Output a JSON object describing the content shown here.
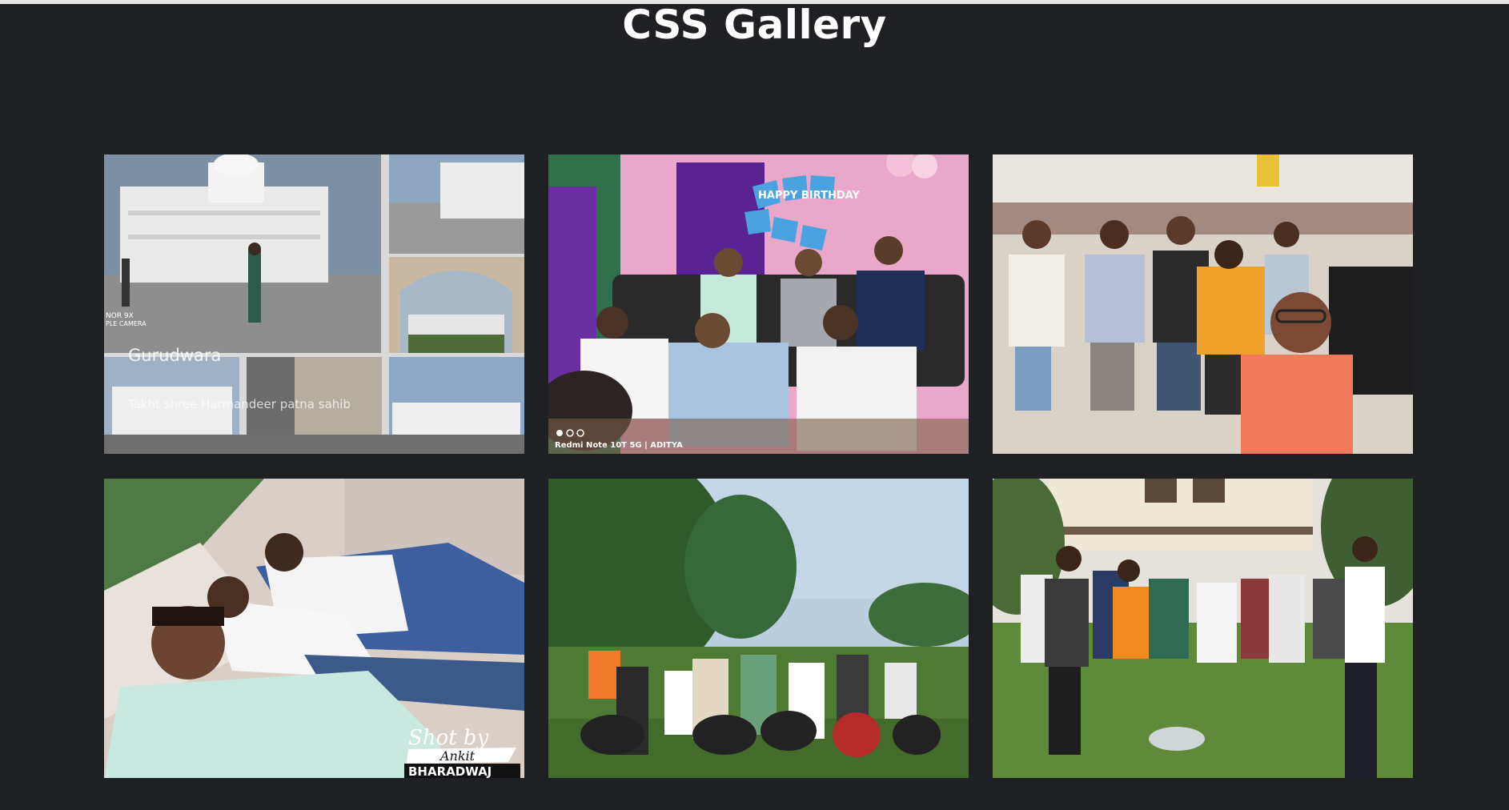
{
  "page": {
    "title": "CSS Gallery"
  },
  "gallery": {
    "items": [
      {
        "subject": "gurudwara-collage",
        "overlay": {
          "camera_line1": "NOR 9X",
          "camera_line2": "PLE CAMERA",
          "caption": "Gurudwara",
          "subcaption": "Takht shree Harmandeer patna sahib"
        }
      },
      {
        "subject": "birthday-group",
        "overlay": {
          "banner": "HAPPY BIRTHDAY",
          "watermark": "Redmi Note 10T 5G | ADITYA"
        }
      },
      {
        "subject": "beach-selfie-group"
      },
      {
        "subject": "selfie-shot-by",
        "overlay": {
          "line1": "Shot by",
          "line2": "Ankit",
          "line3": "BHARADWAJ"
        }
      },
      {
        "subject": "bikes-group-park"
      },
      {
        "subject": "holi-group-lawn"
      }
    ]
  }
}
